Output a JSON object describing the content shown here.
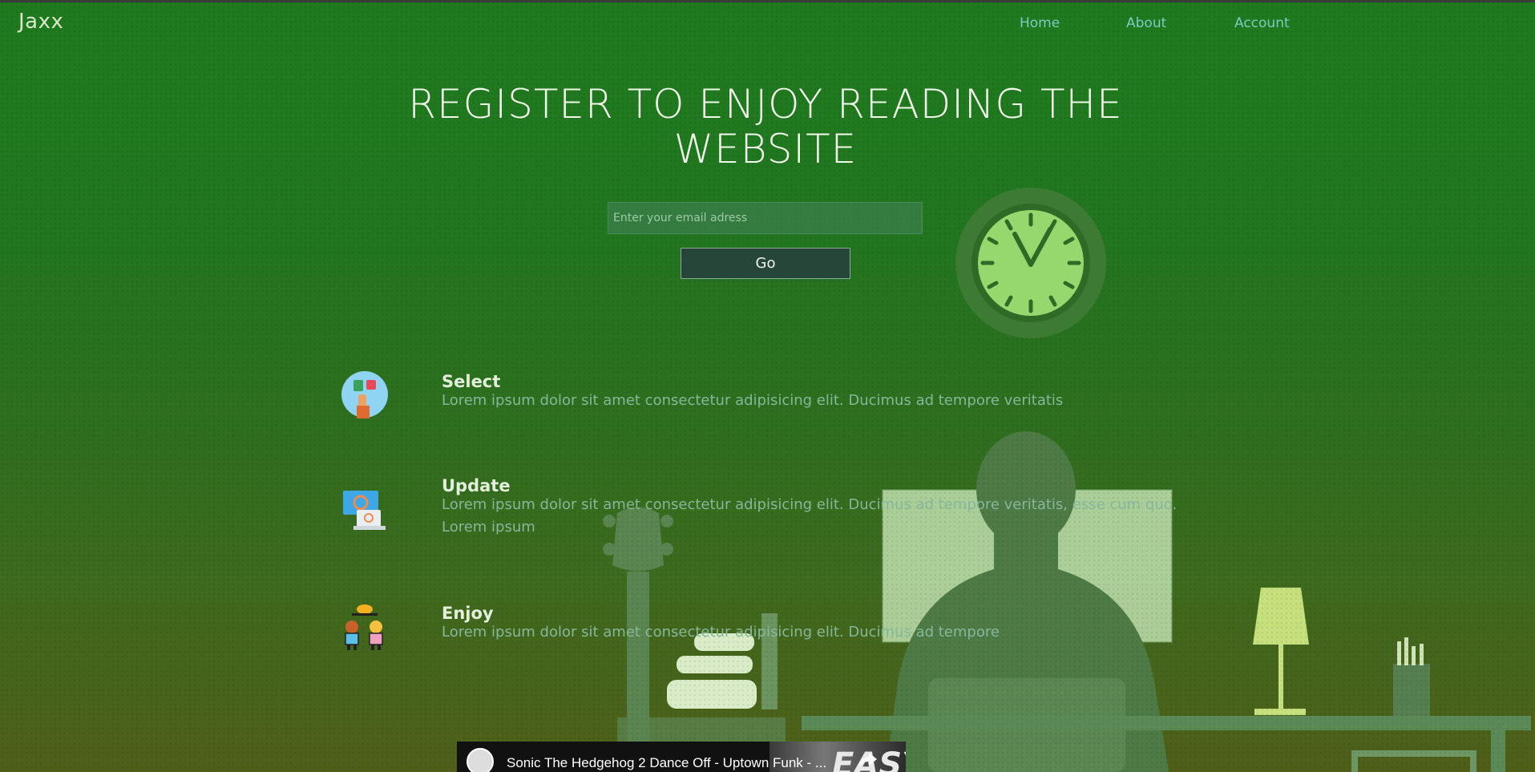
{
  "header": {
    "brand": "Jaxx",
    "nav": [
      "Home",
      "About",
      "Account"
    ]
  },
  "hero": {
    "headline_line1": "REGISTER TO ENJOY READING THE",
    "headline_line2": "WEBSITE",
    "email_placeholder": "Enter your email adress",
    "go_label": "Go"
  },
  "features": [
    {
      "title": "Select",
      "text": "Lorem ipsum dolor sit amet consectetur adipisicing elit. Ducimus ad tempore veritatis",
      "icon": "select-icon"
    },
    {
      "title": "Update",
      "text": "Lorem ipsum dolor sit amet consectetur adipisicing elit. Ducimus ad tempore veritatis, esse cum quo.",
      "text2": "Lorem ipsum",
      "icon": "update-icon"
    },
    {
      "title": "Enjoy",
      "text": "Lorem ipsum dolor sit amet consectetur adipisicing elit. Ducimus ad tempore",
      "icon": "enjoy-icon"
    }
  ],
  "video": {
    "title": "Sonic The Hedgehog 2 Dance Off - Uptown Funk - ...",
    "thumb_text": "EASY"
  },
  "colors": {
    "bg_top": "#1f7a1f",
    "bg_bottom": "#4f5f18",
    "nav_link": "#7fc9c0",
    "button_bg": "#27463a",
    "clock_face": "#96d86e"
  }
}
